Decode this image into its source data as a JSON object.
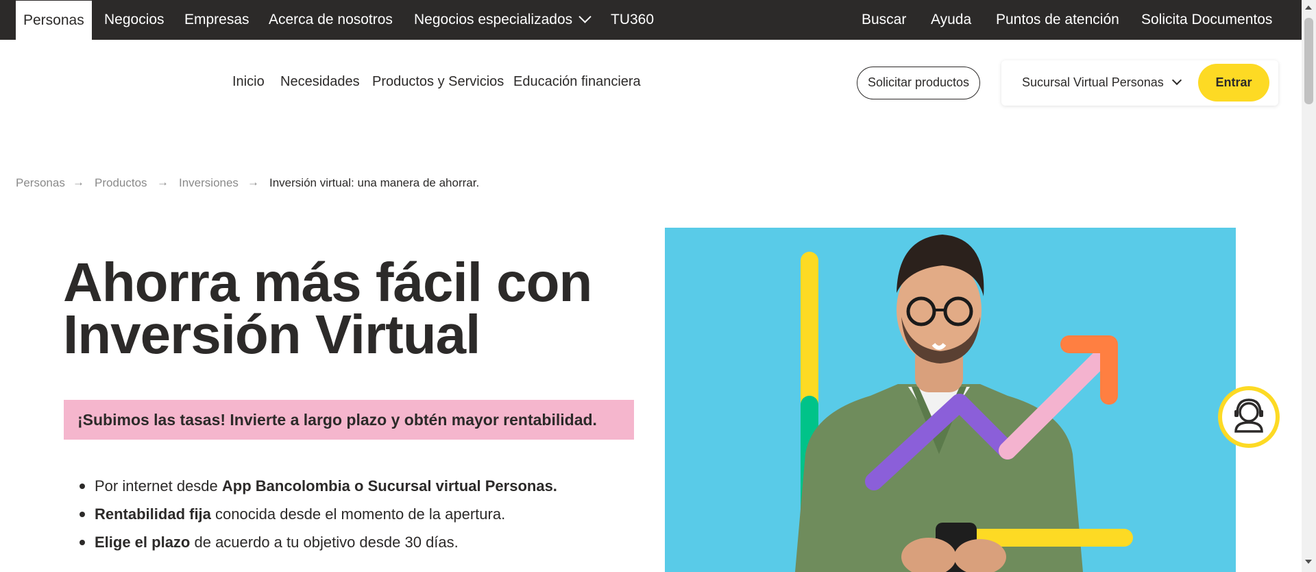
{
  "top_nav": {
    "left_tabs": [
      "Personas",
      "Negocios",
      "Empresas",
      "Acerca de nosotros",
      "Negocios especializados",
      "TU360"
    ],
    "right_links": [
      "Buscar",
      "Ayuda",
      "Puntos de atención",
      "Solicita Documentos"
    ]
  },
  "sub_nav": {
    "links": [
      "Inicio",
      "Necesidades",
      "Productos y Servicios",
      "Educación financiera"
    ],
    "solicitar_label": "Solicitar productos",
    "sucursal_label": "Sucursal Virtual Personas",
    "entrar_label": "Entrar"
  },
  "breadcrumb": [
    "Personas",
    "Productos",
    "Inversiones",
    "Inversión virtual: una manera de ahorrar."
  ],
  "hero": {
    "title_line1": "Ahorra más fácil con",
    "title_line2": "Inversión Virtual",
    "promo": "¡Subimos las tasas! Invierte a largo plazo y obtén mayor rentabilidad.",
    "bullets": [
      {
        "plain_before": "Por internet desde ",
        "bold": "App Bancolombia o Sucursal virtual Personas.",
        "plain_after": ""
      },
      {
        "plain_before": "",
        "bold": "Rentabilidad fija",
        "plain_after": " conocida desde el momento de la apertura."
      },
      {
        "plain_before": "",
        "bold": "Elige el plazo",
        "plain_after": " de acuerdo a tu objetivo desde 30 días."
      }
    ]
  },
  "colors": {
    "brand_yellow": "#fdda24",
    "dark": "#2c2a29",
    "promo_pink": "#f5b6cd",
    "image_bg": "#59cbe8"
  },
  "icons": [
    "chevron-down-icon",
    "arrow-right-icon",
    "chat-assistant-icon"
  ]
}
